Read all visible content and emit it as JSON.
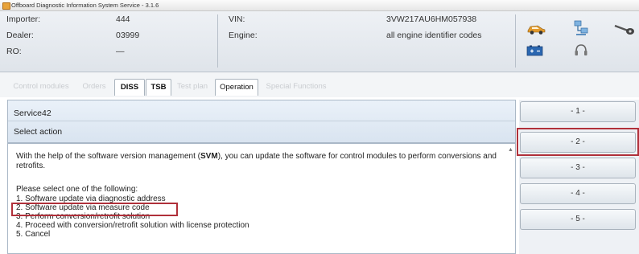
{
  "window": {
    "title": "Offboard Diagnostic Information System Service - 3.1.6"
  },
  "header": {
    "importer_label": "Importer:",
    "importer_value": "444",
    "dealer_label": "Dealer:",
    "dealer_value": "03999",
    "ro_label": "RO:",
    "ro_value": "—",
    "vin_label": "VIN:",
    "vin_value": "3VW217AU6HM057938",
    "engine_label": "Engine:",
    "engine_value": "all engine identifier codes",
    "icons": [
      "car-icon",
      "network-icon",
      "probe-icon",
      "battery-icon",
      "headset-icon"
    ]
  },
  "tabs": [
    {
      "label": "Control modules",
      "state": "disabled"
    },
    {
      "label": "Orders",
      "state": "disabled"
    },
    {
      "label": "DISS",
      "state": "active"
    },
    {
      "label": "TSB",
      "state": "active"
    },
    {
      "label": "Test plan",
      "state": "disabled"
    },
    {
      "label": "Operation",
      "state": "selected"
    },
    {
      "label": "Special Functions",
      "state": "disabled"
    }
  ],
  "main": {
    "service": "Service42",
    "action": "Select action",
    "intro_pre": "With the help of the software version management (",
    "intro_bold": "SVM",
    "intro_post": "), you can update the software for control modules to perform conversions and retrofits.",
    "prompt": "Please select one of the following:",
    "options": [
      "1. Software update via diagnostic address",
      "2. Software update via measure code",
      "3. Perform conversion/retrofit solution",
      "4. Proceed with conversion/retrofit solution with license protection",
      "5. Cancel"
    ],
    "highlighted_option": 2
  },
  "side_buttons": [
    "- 1 -",
    "- 2 -",
    "- 3 -",
    "- 4 -",
    "- 5 -"
  ],
  "highlighted_button": 2,
  "colors": {
    "highlight": "#b0303a",
    "panel": "#dfe4ea"
  }
}
